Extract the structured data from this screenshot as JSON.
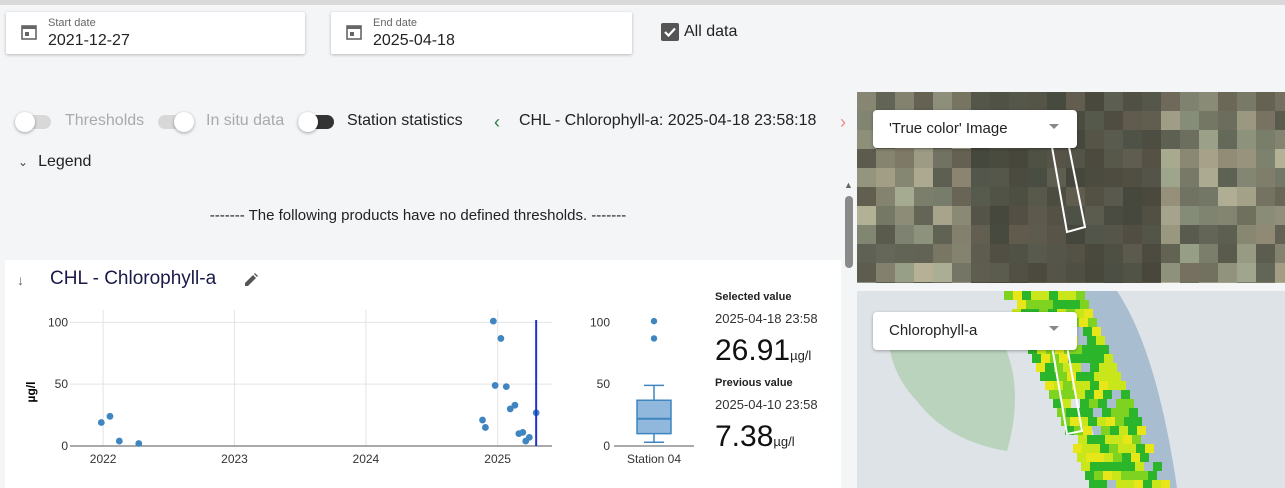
{
  "filters": {
    "start_label": "Start date",
    "start_value": "2021-12-27",
    "end_label": "End date",
    "end_value": "2025-04-18",
    "all_data_label": "All data",
    "all_data_checked": true
  },
  "toggles": {
    "thresholds": "Thresholds",
    "in_situ": "In situ data",
    "station_statistics": "Station statistics"
  },
  "product_nav": {
    "prev_icon": "chevron-left-icon",
    "label": "CHL - Chlorophyll-a: 2025-04-18 23:58:18",
    "next_icon": "chevron-right-icon"
  },
  "legend": {
    "label": "Legend",
    "notice": "------- The following products have no defined thresholds. -------"
  },
  "panel": {
    "title": "CHL - Chlorophyll-a",
    "selected_heading": "Selected value",
    "selected_date": "2025-04-18 23:58",
    "selected_value": "26.91",
    "unit": "µg/l",
    "previous_heading": "Previous value",
    "previous_date": "2025-04-10 23:58",
    "previous_value": "7.38"
  },
  "map": {
    "top_layer": "'True color' Image",
    "bottom_layer": "Chlorophyll-a"
  },
  "colors": {
    "point": "#3f86c0",
    "marker_line": "#2233cc",
    "box_fill": "#8fb8dc",
    "box_stroke": "#3f86c0"
  },
  "chart_data": [
    {
      "type": "scatter",
      "title": "",
      "xlabel": "",
      "ylabel": "µg/l",
      "ylim": [
        0,
        110
      ],
      "xlim": [
        "2021-10-01",
        "2025-06-01"
      ],
      "x_ticks": [
        "2022",
        "2023",
        "2024",
        "2025"
      ],
      "y_ticks": [
        0,
        50,
        100
      ],
      "grid": true,
      "series": [
        {
          "points": [
            {
              "x": "2021-12-27",
              "y": 19
            },
            {
              "x": "2022-01-20",
              "y": 24
            },
            {
              "x": "2022-02-15",
              "y": 4
            },
            {
              "x": "2022-04-10",
              "y": 2
            },
            {
              "x": "2024-11-20",
              "y": 21
            },
            {
              "x": "2024-11-28",
              "y": 15
            },
            {
              "x": "2024-12-20",
              "y": 101
            },
            {
              "x": "2024-12-25",
              "y": 49
            },
            {
              "x": "2025-01-10",
              "y": 87
            },
            {
              "x": "2025-01-25",
              "y": 48
            },
            {
              "x": "2025-02-05",
              "y": 30
            },
            {
              "x": "2025-02-18",
              "y": 33
            },
            {
              "x": "2025-03-01",
              "y": 10
            },
            {
              "x": "2025-03-12",
              "y": 11
            },
            {
              "x": "2025-03-20",
              "y": 4
            },
            {
              "x": "2025-03-30",
              "y": 7
            },
            {
              "x": "2025-04-18",
              "y": 26.91
            }
          ]
        }
      ],
      "selected_x": "2025-04-18"
    },
    {
      "type": "box",
      "category": "Station 04",
      "y_ticks": [
        0,
        50,
        100
      ],
      "ylim": [
        0,
        110
      ],
      "whisker_low": 3,
      "q1": 10,
      "median": 22,
      "q3": 37,
      "whisker_high": 49,
      "outliers": [
        87,
        101
      ]
    }
  ]
}
